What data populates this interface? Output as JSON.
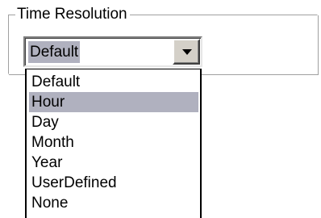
{
  "group": {
    "title": "Time Resolution"
  },
  "combo": {
    "selected_value": "Default"
  },
  "dropdown": {
    "items": [
      {
        "label": "Default"
      },
      {
        "label": "Hour"
      },
      {
        "label": "Day"
      },
      {
        "label": "Month"
      },
      {
        "label": "Year"
      },
      {
        "label": "UserDefined"
      },
      {
        "label": "None"
      }
    ],
    "highlighted_index": 1
  },
  "colors": {
    "highlight": "#b0b1bf",
    "button_face": "#d4d0c8"
  },
  "icons": {
    "combo_button": "chevron-down-icon"
  }
}
